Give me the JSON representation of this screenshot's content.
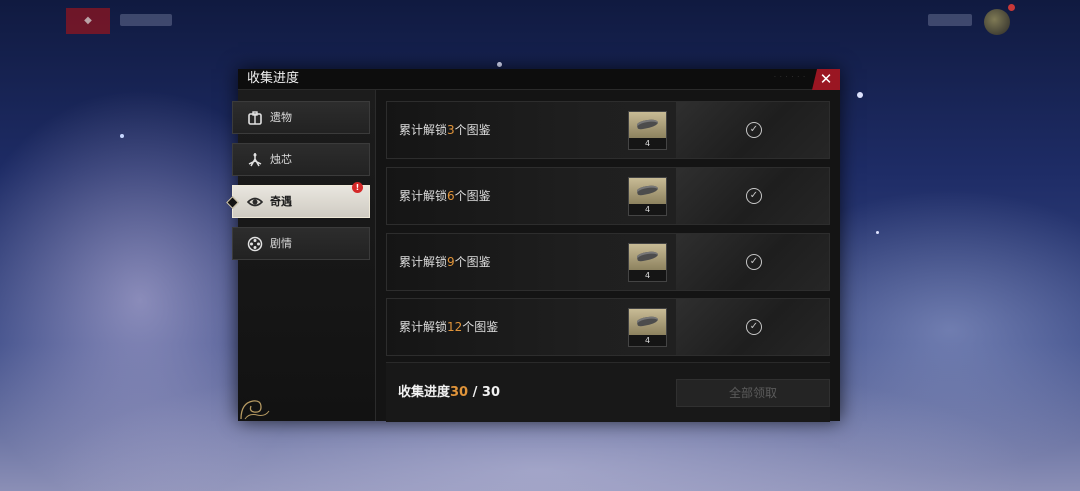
{
  "background": {
    "accent_red": "#9a1622",
    "highlight_orange": "#e0943a"
  },
  "topbar": {
    "badge_icon": "game-logo-icon",
    "coin_icon": "currency-icon"
  },
  "dialog": {
    "title": "收集进度",
    "close_label": "✕",
    "tabs": [
      {
        "label": "遗物",
        "icon": "relic-icon",
        "active": false,
        "alert": false
      },
      {
        "label": "烛芯",
        "icon": "wick-icon",
        "active": false,
        "alert": false
      },
      {
        "label": "奇遇",
        "icon": "eye-icon",
        "active": true,
        "alert": true,
        "alert_label": "!"
      },
      {
        "label": "剧情",
        "icon": "film-reel-icon",
        "active": false,
        "alert": false
      }
    ],
    "rows": [
      {
        "prefix": "累计解锁",
        "count": "3",
        "suffix": "个图鉴",
        "reward_count": "4",
        "claimed": true
      },
      {
        "prefix": "累计解锁",
        "count": "6",
        "suffix": "个图鉴",
        "reward_count": "4",
        "claimed": true
      },
      {
        "prefix": "累计解锁",
        "count": "9",
        "suffix": "个图鉴",
        "reward_count": "4",
        "claimed": true
      },
      {
        "prefix": "累计解锁",
        "count": "12",
        "suffix": "个图鉴",
        "reward_count": "4",
        "claimed": true
      }
    ],
    "footer": {
      "progress_label": "收集进度",
      "progress_current": "30",
      "progress_sep": " / ",
      "progress_total": "30",
      "claim_all_label": "全部领取"
    }
  }
}
